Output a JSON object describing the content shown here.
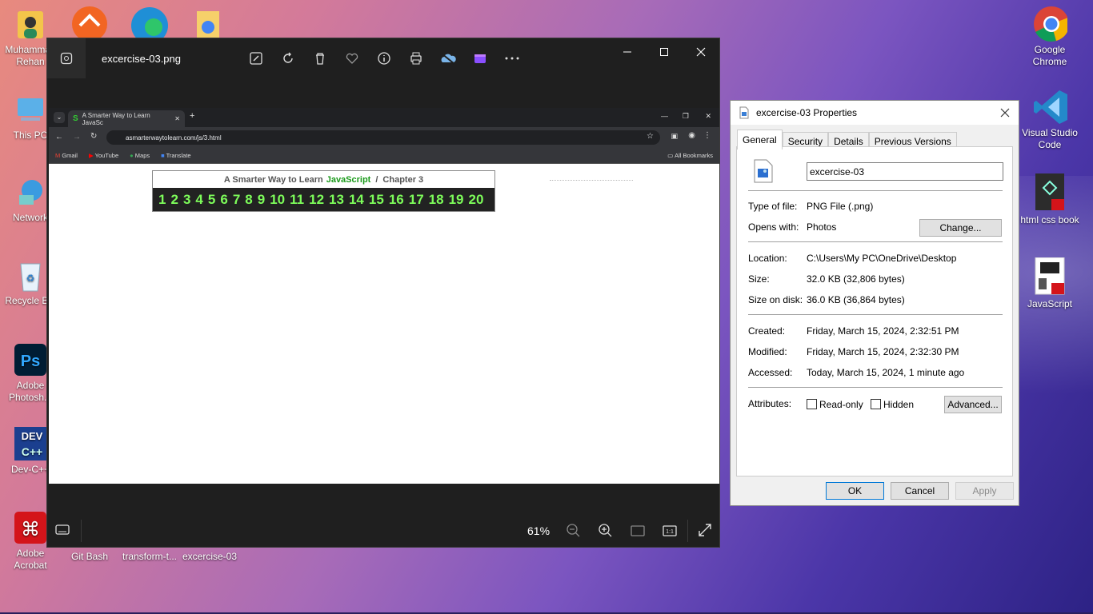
{
  "desktop": {
    "icons_left": [
      {
        "label": "Muhammad Rehan",
        "icon": "user-folder-icon"
      },
      {
        "label": "This PC",
        "icon": "computer-icon"
      },
      {
        "label": "Network",
        "icon": "network-icon"
      },
      {
        "label": "Recycle Bin",
        "icon": "recycle-bin-icon"
      },
      {
        "label": "Adobe Photosh...",
        "icon": "photoshop-icon"
      },
      {
        "label": "Dev-C++",
        "icon": "devcpp-icon"
      },
      {
        "label": "Adobe Acrobat",
        "icon": "acrobat-icon"
      }
    ],
    "icons_bottom": [
      {
        "label": "Git Bash"
      },
      {
        "label": "transform-t..."
      },
      {
        "label": "excercise-03"
      }
    ],
    "icons_right": [
      {
        "label": "Google Chrome",
        "icon": "chrome-icon"
      },
      {
        "label": "Visual Studio Code",
        "icon": "vscode-icon"
      },
      {
        "label": "html css book",
        "icon": "pdf-icon"
      },
      {
        "label": "JavaScript",
        "icon": "pdf-icon"
      }
    ]
  },
  "photos": {
    "title": "excercise-03.png",
    "zoom": "61%",
    "browser": {
      "tab_title": "A Smarter Way to Learn JavaSc",
      "url": "asmarterwaytolearn.com/js/3.html",
      "bookmarks": [
        "Gmail",
        "YouTube",
        "Maps",
        "Translate"
      ],
      "all_bookmarks": "All Bookmarks"
    },
    "page": {
      "title_prefix": "A Smarter Way to Learn",
      "title_js": "JavaScript",
      "title_sep": "/",
      "title_chapter": "Chapter 3",
      "numbers": [
        "1",
        "2",
        "3",
        "4",
        "5",
        "6",
        "7",
        "8",
        "9",
        "10",
        "11",
        "12",
        "13",
        "14",
        "15",
        "16",
        "17",
        "18",
        "19",
        "20"
      ]
    }
  },
  "properties": {
    "title": "excercise-03 Properties",
    "tabs": [
      "General",
      "Security",
      "Details",
      "Previous Versions"
    ],
    "filename": "excercise-03",
    "type_label": "Type of file:",
    "type_value": "PNG File (.png)",
    "opens_label": "Opens with:",
    "opens_value": "Photos",
    "change_btn": "Change...",
    "location_label": "Location:",
    "location_value": "C:\\Users\\My PC\\OneDrive\\Desktop",
    "size_label": "Size:",
    "size_value": "32.0 KB (32,806 bytes)",
    "sizedisk_label": "Size on disk:",
    "sizedisk_value": "36.0 KB (36,864 bytes)",
    "created_label": "Created:",
    "created_value": "Friday, March 15, 2024, 2:32:51 PM",
    "modified_label": "Modified:",
    "modified_value": "Friday, March 15, 2024, 2:32:30 PM",
    "accessed_label": "Accessed:",
    "accessed_value": "Today, March 15, 2024, 1 minute ago",
    "attributes_label": "Attributes:",
    "readonly_label": "Read-only",
    "hidden_label": "Hidden",
    "advanced_btn": "Advanced...",
    "ok_btn": "OK",
    "cancel_btn": "Cancel",
    "apply_btn": "Apply"
  }
}
